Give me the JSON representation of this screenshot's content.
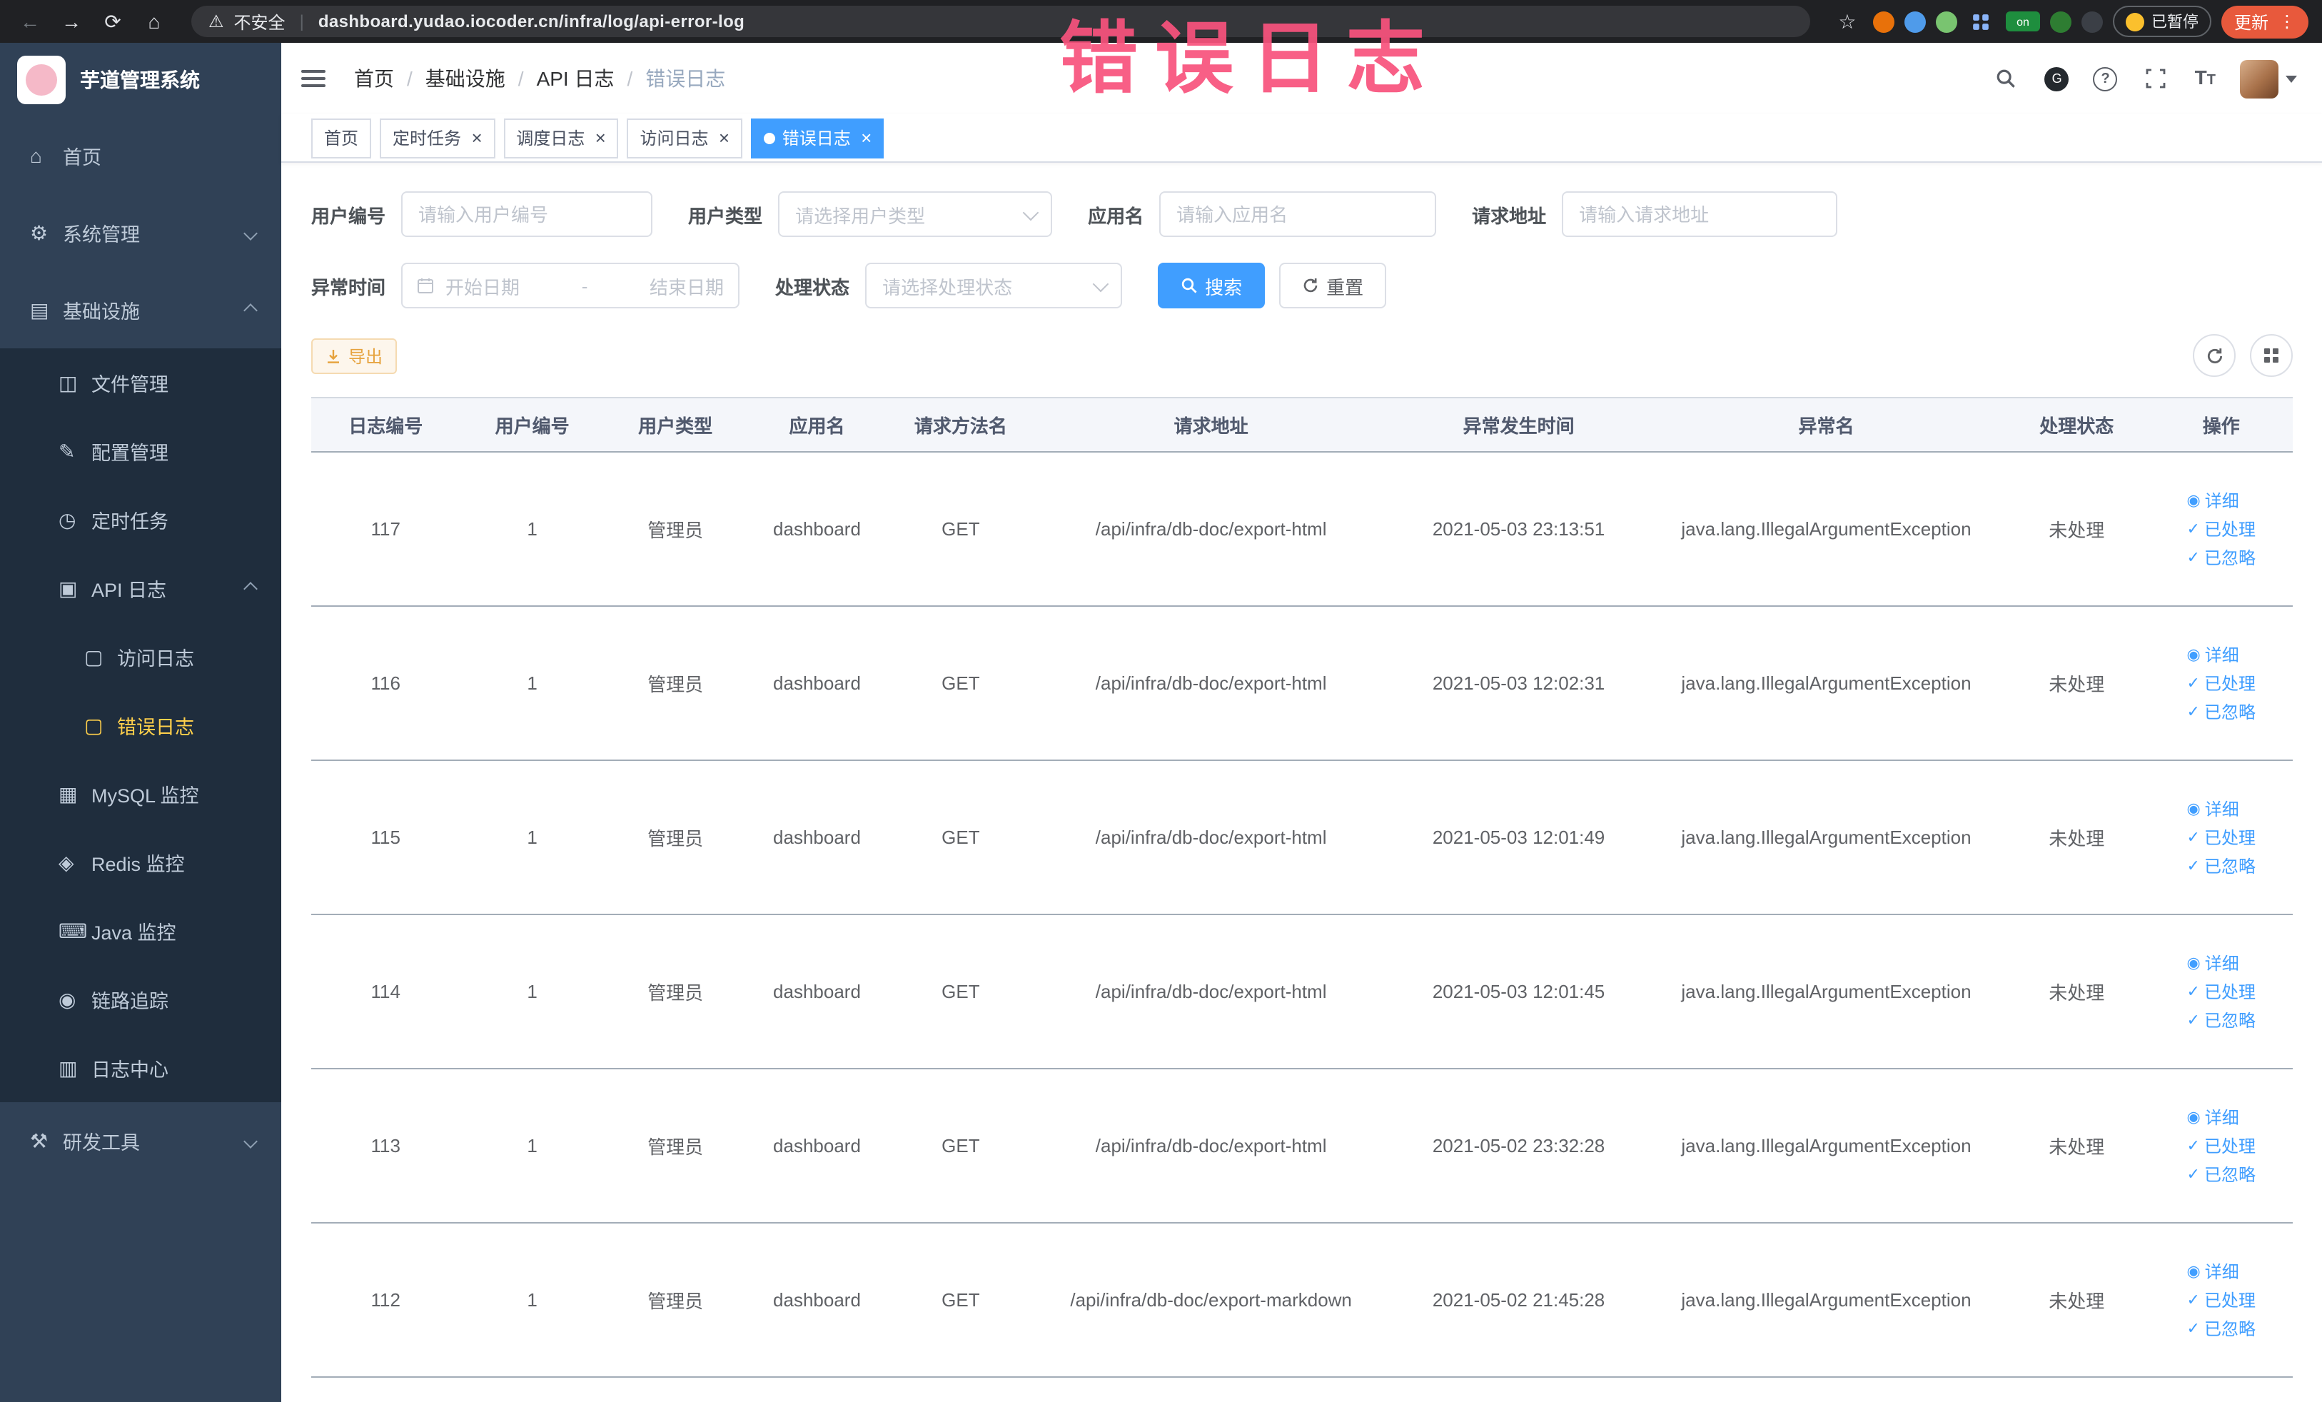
{
  "browser": {
    "security_label": "不安全",
    "url": "dashboard.yudao.iocoder.cn/infra/log/api-error-log",
    "on_badge": "on",
    "paused_badge": "已暂停",
    "update_button": "更新"
  },
  "annotation": "错误日志",
  "sidebar": {
    "logo_title": "芋道管理系统",
    "items": [
      {
        "key": "home",
        "label": "首页",
        "icon": "home",
        "level": 0
      },
      {
        "key": "system",
        "label": "系统管理",
        "icon": "gear",
        "level": 0,
        "chevron": "down"
      },
      {
        "key": "infra",
        "label": "基础设施",
        "icon": "monitor",
        "level": 0,
        "chevron": "up"
      },
      {
        "key": "file",
        "label": "文件管理",
        "icon": "folder",
        "level": 1
      },
      {
        "key": "config",
        "label": "配置管理",
        "icon": "edit",
        "level": 1
      },
      {
        "key": "job",
        "label": "定时任务",
        "icon": "clock",
        "level": 1
      },
      {
        "key": "api-log",
        "label": "API 日志",
        "icon": "log",
        "level": 1,
        "chevron": "up"
      },
      {
        "key": "access-log",
        "label": "访问日志",
        "icon": "doc",
        "level": 2
      },
      {
        "key": "error-log",
        "label": "错误日志",
        "icon": "doc",
        "level": 2,
        "active": true
      },
      {
        "key": "mysql",
        "label": "MySQL 监控",
        "icon": "database",
        "level": 1
      },
      {
        "key": "redis",
        "label": "Redis 监控",
        "icon": "redis",
        "level": 1
      },
      {
        "key": "java",
        "label": "Java 监控",
        "icon": "java",
        "level": 1
      },
      {
        "key": "trace",
        "label": "链路追踪",
        "icon": "trace",
        "level": 1
      },
      {
        "key": "log-center",
        "label": "日志中心",
        "icon": "log-center",
        "level": 1
      },
      {
        "key": "dev-tools",
        "label": "研发工具",
        "icon": "tools",
        "level": 0,
        "chevron": "down"
      }
    ]
  },
  "header": {
    "breadcrumb": [
      "首页",
      "基础设施",
      "API 日志",
      "错误日志"
    ]
  },
  "tabs": [
    {
      "label": "首页",
      "closable": false,
      "active": false
    },
    {
      "label": "定时任务",
      "closable": true,
      "active": false
    },
    {
      "label": "调度日志",
      "closable": true,
      "active": false
    },
    {
      "label": "访问日志",
      "closable": true,
      "active": false
    },
    {
      "label": "错误日志",
      "closable": true,
      "active": true
    }
  ],
  "filters": {
    "user_id": {
      "label": "用户编号",
      "placeholder": "请输入用户编号"
    },
    "user_type": {
      "label": "用户类型",
      "placeholder": "请选择用户类型"
    },
    "app_name": {
      "label": "应用名",
      "placeholder": "请输入应用名"
    },
    "request_url": {
      "label": "请求地址",
      "placeholder": "请输入请求地址"
    },
    "exception_time": {
      "label": "异常时间",
      "start_placeholder": "开始日期",
      "separator": "-",
      "end_placeholder": "结束日期"
    },
    "process_status": {
      "label": "处理状态",
      "placeholder": "请选择处理状态"
    },
    "search_button": "搜索",
    "reset_button": "重置"
  },
  "toolbar": {
    "export_button": "导出"
  },
  "table": {
    "columns": [
      "日志编号",
      "用户编号",
      "用户类型",
      "应用名",
      "请求方法名",
      "请求地址",
      "异常发生时间",
      "异常名",
      "处理状态",
      "操作"
    ],
    "actions": [
      "详细",
      "已处理",
      "已忽略"
    ],
    "rows": [
      {
        "id": "117",
        "user_id": "1",
        "user_type": "管理员",
        "app": "dashboard",
        "method": "GET",
        "url": "/api/infra/db-doc/export-html",
        "time": "2021-05-03 23:13:51",
        "exception": "java.lang.IllegalArgumentException",
        "status": "未处理"
      },
      {
        "id": "116",
        "user_id": "1",
        "user_type": "管理员",
        "app": "dashboard",
        "method": "GET",
        "url": "/api/infra/db-doc/export-html",
        "time": "2021-05-03 12:02:31",
        "exception": "java.lang.IllegalArgumentException",
        "status": "未处理"
      },
      {
        "id": "115",
        "user_id": "1",
        "user_type": "管理员",
        "app": "dashboard",
        "method": "GET",
        "url": "/api/infra/db-doc/export-html",
        "time": "2021-05-03 12:01:49",
        "exception": "java.lang.IllegalArgumentException",
        "status": "未处理"
      },
      {
        "id": "114",
        "user_id": "1",
        "user_type": "管理员",
        "app": "dashboard",
        "method": "GET",
        "url": "/api/infra/db-doc/export-html",
        "time": "2021-05-03 12:01:45",
        "exception": "java.lang.IllegalArgumentException",
        "status": "未处理"
      },
      {
        "id": "113",
        "user_id": "1",
        "user_type": "管理员",
        "app": "dashboard",
        "method": "GET",
        "url": "/api/infra/db-doc/export-html",
        "time": "2021-05-02 23:32:28",
        "exception": "java.lang.IllegalArgumentException",
        "status": "未处理"
      },
      {
        "id": "112",
        "user_id": "1",
        "user_type": "管理员",
        "app": "dashboard",
        "method": "GET",
        "url": "/api/infra/db-doc/export-markdown",
        "time": "2021-05-02 21:45:28",
        "exception": "java.lang.IllegalArgumentException",
        "status": "未处理"
      }
    ]
  }
}
